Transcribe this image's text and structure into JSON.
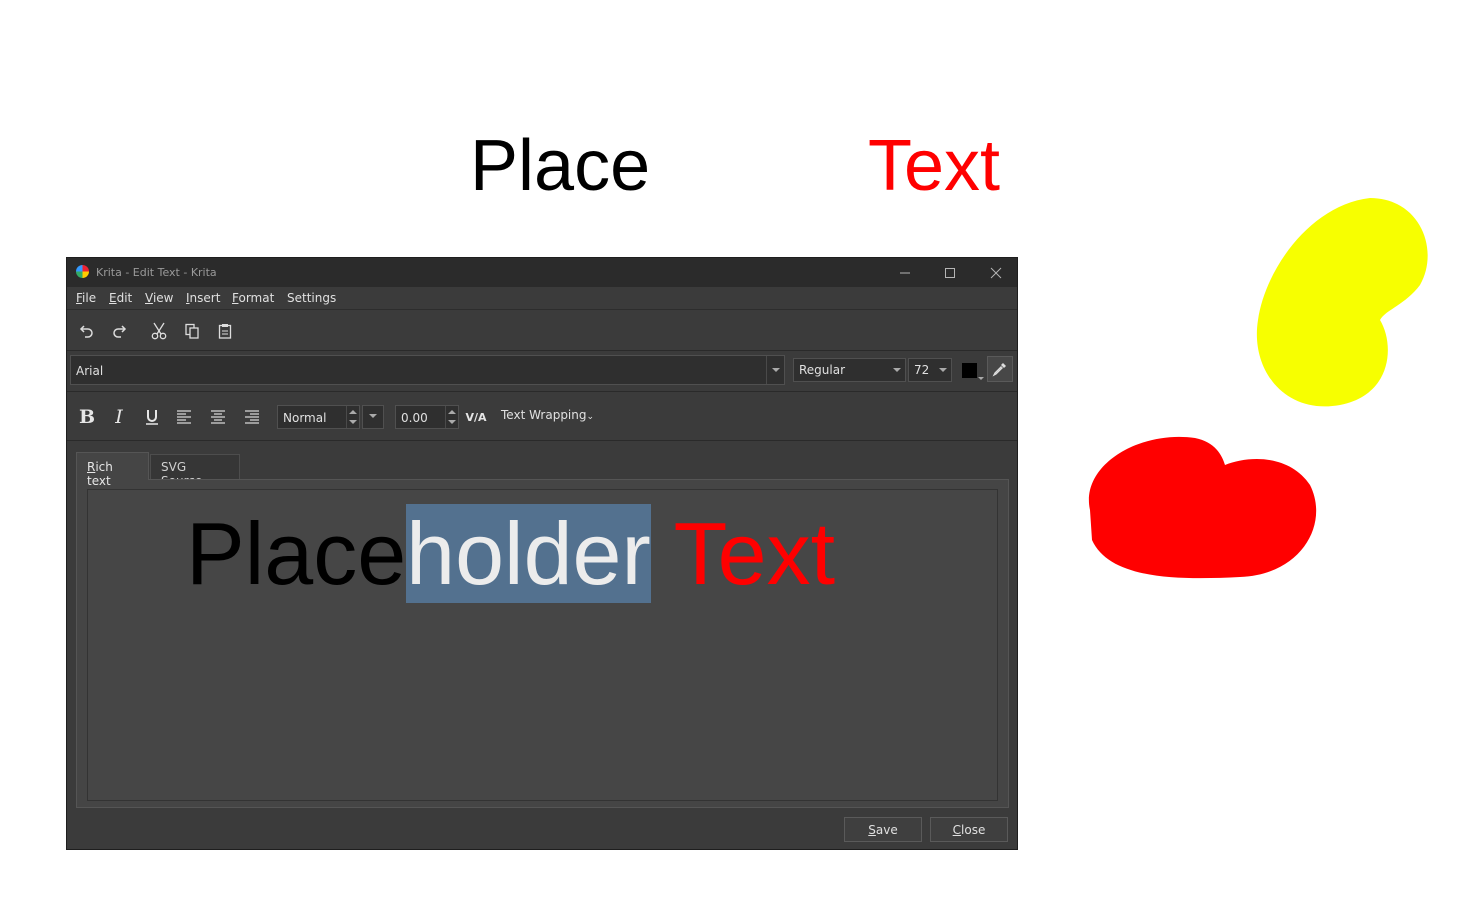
{
  "canvas": {
    "word_place": "Place",
    "word_text": "Text",
    "colors": {
      "black": "#000000",
      "red": "#ff0000",
      "yellow": "#f7ff00"
    }
  },
  "window": {
    "title": "Krita - Edit Text - Krita",
    "controls": [
      "minimize-icon",
      "maximize-icon",
      "close-icon"
    ]
  },
  "menubar": {
    "items": [
      {
        "label_ul": "F",
        "label_rest": "ile"
      },
      {
        "label_ul": "E",
        "label_rest": "dit"
      },
      {
        "label_ul": "V",
        "label_rest": "iew"
      },
      {
        "label_ul": "I",
        "label_rest": "nsert"
      },
      {
        "label_ul": "F",
        "label_rest": "ormat"
      },
      {
        "label_ul": "",
        "label_rest": "Settings"
      }
    ]
  },
  "toolbar": {
    "icons": [
      "undo-icon",
      "redo-icon",
      "cut-icon",
      "copy-icon",
      "paste-icon"
    ]
  },
  "font": {
    "family": "Arial",
    "style": "Regular",
    "size": "72",
    "color": "#000000"
  },
  "format": {
    "line_spacing": "Normal",
    "letter_spacing": "0.00",
    "text_wrapping": "Text Wrapping"
  },
  "tabs": {
    "rich_ul": "R",
    "rich_rest": "ich text",
    "svg_pre": "SVG So",
    "svg_ul": "u",
    "svg_rest": "rce"
  },
  "editor": {
    "seg1": "Place",
    "seg2": "holder",
    "seg3": " Text",
    "selection_color": "#53718f"
  },
  "buttons": {
    "save_ul": "S",
    "save_rest": "ave",
    "close_ul": "C",
    "close_rest": "lose"
  }
}
